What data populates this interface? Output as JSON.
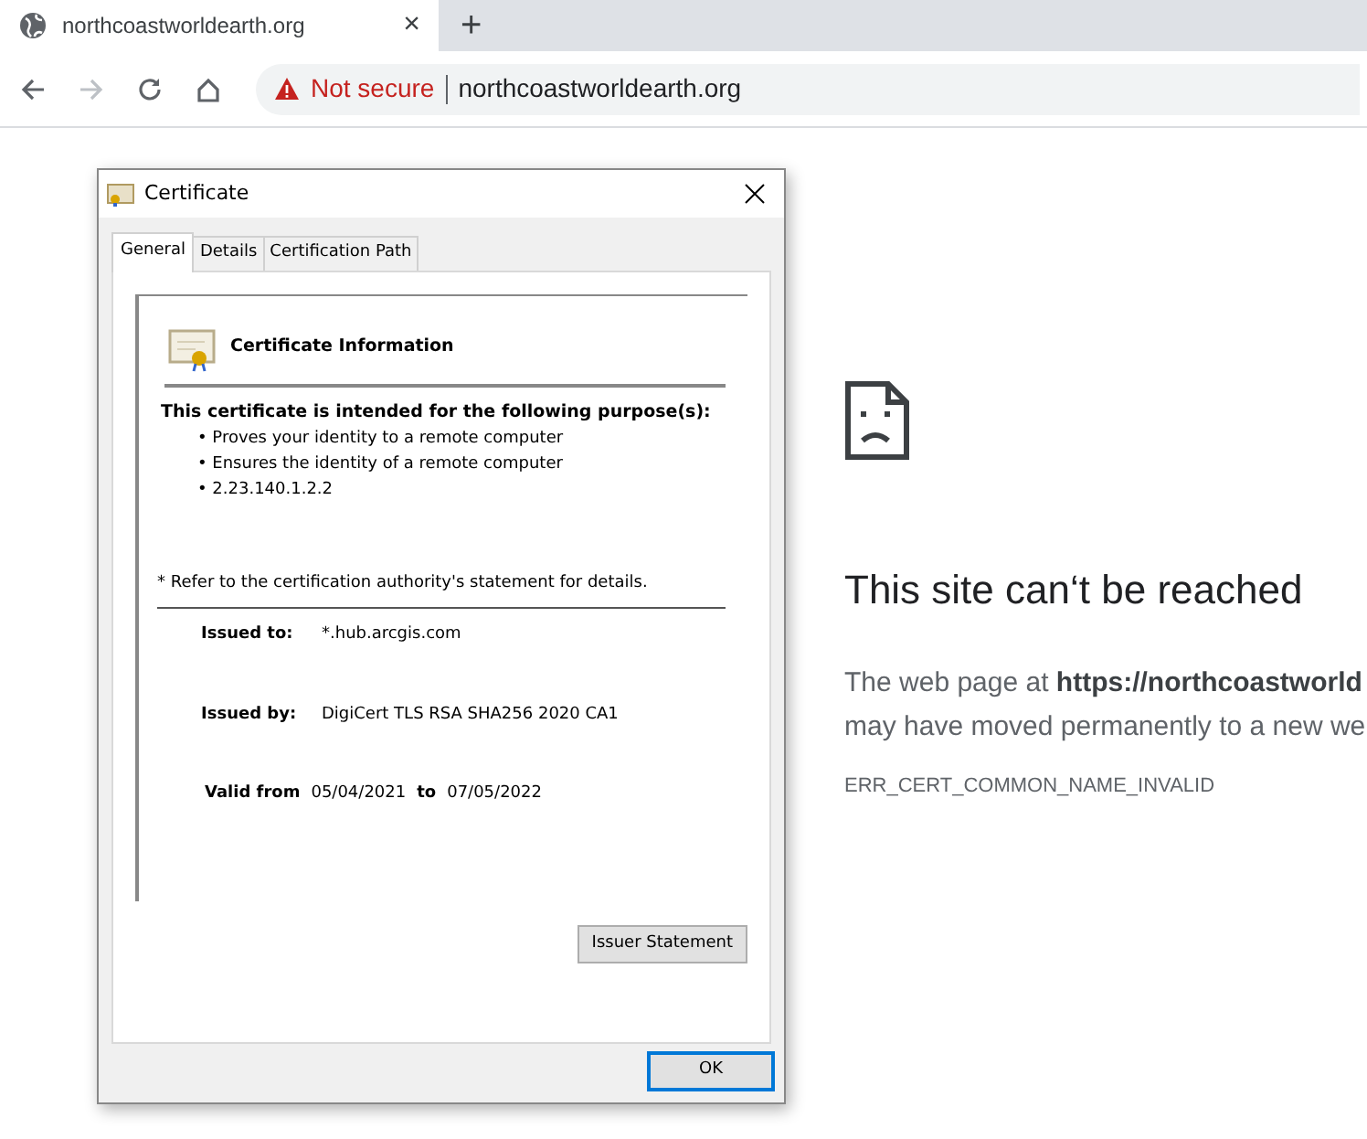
{
  "browser": {
    "tabs": [
      {
        "title": "northcoastworldearth.org",
        "selected": true
      }
    ],
    "tab_close": "×",
    "new_tab": "+",
    "security_label": "Not secure",
    "url": "northcoastworldearth.org"
  },
  "error_page": {
    "heading": "This site can‘t be reached",
    "lines": [
      "The web page at **https://northcoastworld**",
      "may have moved permanently to a new we"
    ],
    "code": "ERR_CERT_COMMON_NAME_INVALID"
  },
  "dialog": {
    "title": "Certificate",
    "tabs": [
      {
        "label": "General",
        "selected": true
      },
      {
        "label": "Details",
        "selected": false
      },
      {
        "label": "Certification Path",
        "selected": false
      }
    ],
    "heading": "Certificate Information",
    "purpose_title": "This certificate is intended for the following purpose(s):",
    "purposes": [
      "• Proves your identity to a remote computer",
      "• Ensures the identity of a remote computer",
      "• 2.23.140.1.2.2"
    ],
    "note": "* Refer to the certification authority's statement for details.",
    "issued_to": {
      "label": "Issued to:",
      "value": "*.hub.arcgis.com"
    },
    "issued_by": {
      "label": "Issued by:",
      "value": "DigiCert TLS RSA SHA256 2020 CA1"
    },
    "validity": {
      "label": "Valid from",
      "from": "05/04/2021",
      "to_label": "to",
      "to": "07/05/2022"
    },
    "issuer_button": "Issuer Statement",
    "ok_button": "OK"
  }
}
